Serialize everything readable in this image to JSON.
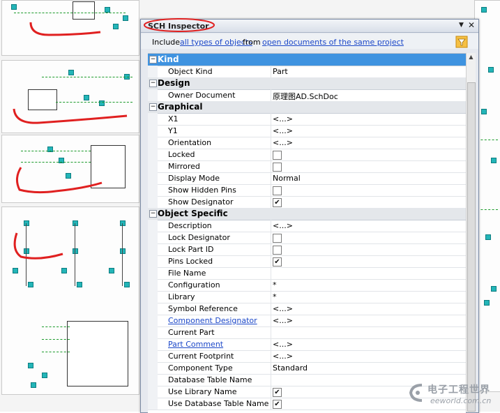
{
  "inspector": {
    "title": "SCH Inspector",
    "include": {
      "prefix": "Include",
      "scope_link": "all types of objects",
      "middle": "from",
      "source_link": "open documents of the same project"
    },
    "sections": [
      {
        "title": "Kind",
        "selected": true,
        "rows": [
          {
            "name": "Object Kind",
            "value": "Part"
          }
        ]
      },
      {
        "title": "Design",
        "rows": [
          {
            "name": "Owner Document",
            "value": "原理图AD.SchDoc"
          }
        ]
      },
      {
        "title": "Graphical",
        "rows": [
          {
            "name": "X1",
            "value": "<...>"
          },
          {
            "name": "Y1",
            "value": "<...>"
          },
          {
            "name": "Orientation",
            "value": "<...>"
          },
          {
            "name": "Locked",
            "checkbox": false
          },
          {
            "name": "Mirrored",
            "checkbox": false
          },
          {
            "name": "Display Mode",
            "value": "Normal"
          },
          {
            "name": "Show Hidden Pins",
            "checkbox": false
          },
          {
            "name": "Show Designator",
            "checkbox": true
          }
        ]
      },
      {
        "title": "Object Specific",
        "rows": [
          {
            "name": "Description",
            "value": "<...>"
          },
          {
            "name": "Lock Designator",
            "checkbox": false
          },
          {
            "name": "Lock Part ID",
            "checkbox": false
          },
          {
            "name": "Pins Locked",
            "checkbox": true
          },
          {
            "name": "File Name",
            "value": ""
          },
          {
            "name": "Configuration",
            "value": "*"
          },
          {
            "name": "Library",
            "value": "*"
          },
          {
            "name": "Symbol Reference",
            "value": "<...>"
          },
          {
            "name": "Component Designator",
            "value": "<...>",
            "link": true
          },
          {
            "name": "Current Part",
            "value": ""
          },
          {
            "name": "Part Comment",
            "value": "<...>",
            "link": true
          },
          {
            "name": "Current Footprint",
            "value": "<...>"
          },
          {
            "name": "Component Type",
            "value": "Standard"
          },
          {
            "name": "Database Table Name",
            "value": ""
          },
          {
            "name": "Use Library Name",
            "checkbox": true
          },
          {
            "name": "Use Database Table Name",
            "checkbox": true
          }
        ]
      }
    ],
    "icons": {
      "pin": "dropdown-pin-icon",
      "close": "close-icon",
      "filter": "funnel-filter-icon"
    },
    "colors": {
      "selected_section": "#3f93e0",
      "link": "#1b47c8"
    }
  },
  "watermark": {
    "text": "电子工程世界",
    "url": "eeworld.com.cn"
  }
}
